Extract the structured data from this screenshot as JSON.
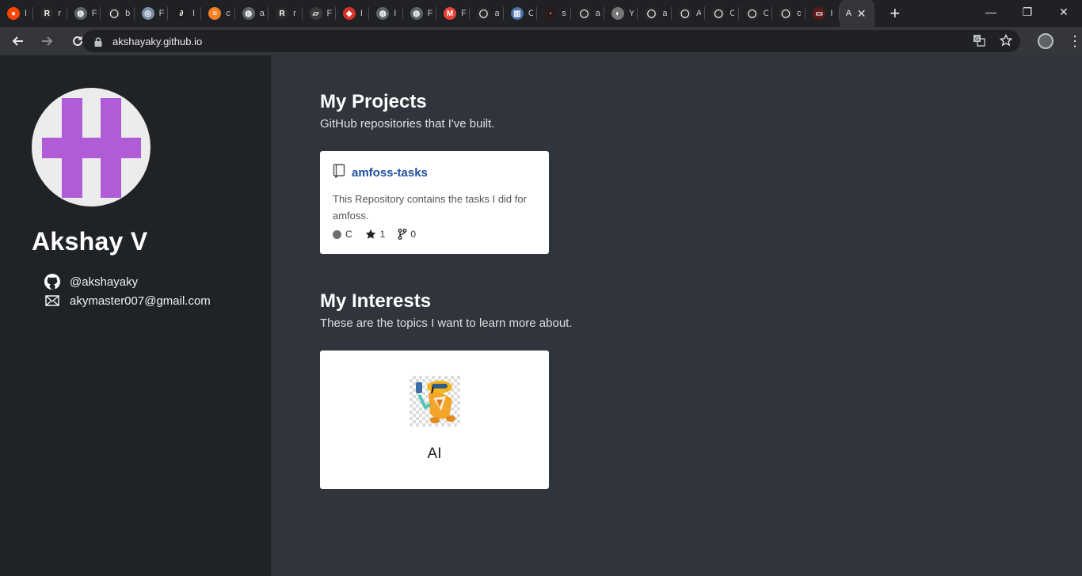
{
  "browser": {
    "tabs": [
      {
        "initial": "I",
        "color": "#ff4500",
        "glyph": "●"
      },
      {
        "initial": "r",
        "color": "#2a2a2a",
        "glyph": "R"
      },
      {
        "initial": "F",
        "color": "#5f6368",
        "glyph": "◍"
      },
      {
        "initial": "b",
        "color": "#2a2a2a",
        "glyph": "◯"
      },
      {
        "initial": "F",
        "color": "#7a8ea8",
        "glyph": "◎"
      },
      {
        "initial": "I",
        "color": "#1e1e1e",
        "glyph": "∂"
      },
      {
        "initial": "c",
        "color": "#f48024",
        "glyph": "≡"
      },
      {
        "initial": "a",
        "color": "#5f6368",
        "glyph": "◍"
      },
      {
        "initial": "r",
        "color": "#2a2a2a",
        "glyph": "R"
      },
      {
        "initial": "F",
        "color": "#3a3a3a",
        "glyph": "▱"
      },
      {
        "initial": "I",
        "color": "#d93025",
        "glyph": "◆"
      },
      {
        "initial": "I",
        "color": "#5f6368",
        "glyph": "◍"
      },
      {
        "initial": "F",
        "color": "#5f6368",
        "glyph": "◍"
      },
      {
        "initial": "F",
        "color": "#ea4335",
        "glyph": "M"
      },
      {
        "initial": "a",
        "color": "#2a2a2a",
        "glyph": "◯"
      },
      {
        "initial": "C",
        "color": "#4b6fa8",
        "glyph": "▥"
      },
      {
        "initial": "s",
        "color": "#2b1a1a",
        "glyph": "·"
      },
      {
        "initial": "a",
        "color": "#2a2a2a",
        "glyph": "◯"
      },
      {
        "initial": "Y",
        "color": "#777777",
        "glyph": "◐"
      },
      {
        "initial": "a",
        "color": "#2a2a2a",
        "glyph": "◯"
      },
      {
        "initial": "A",
        "color": "#2a2a2a",
        "glyph": "◯"
      },
      {
        "initial": "C",
        "color": "#2a2a2a",
        "glyph": "◯"
      },
      {
        "initial": "C",
        "color": "#2a2a2a",
        "glyph": "◯"
      },
      {
        "initial": "c",
        "color": "#2a2a2a",
        "glyph": "◯"
      },
      {
        "initial": "I",
        "color": "#5a1a1a",
        "glyph": "▭"
      }
    ],
    "active_tab": {
      "initial": "A",
      "close": "✕"
    },
    "new_tab": "+",
    "window": {
      "minimize": "—",
      "restore": "❐",
      "close": "✕"
    },
    "url": "akshayaky.github.io"
  },
  "profile": {
    "name": "Akshay V",
    "github": "@akshayaky",
    "email": "akymaster007@gmail.com",
    "logo_color": "#b05cd6"
  },
  "projects": {
    "title": "My Projects",
    "subtitle": "GitHub repositories that I've built.",
    "items": [
      {
        "name": "amfoss-tasks",
        "description": "This Repository contains the tasks I did for amfoss.",
        "language": "C",
        "stars": "1",
        "forks": "0"
      }
    ]
  },
  "interests": {
    "title": "My Interests",
    "subtitle": "These are the topics I want to learn more about.",
    "items": [
      {
        "label": "AI"
      }
    ]
  }
}
